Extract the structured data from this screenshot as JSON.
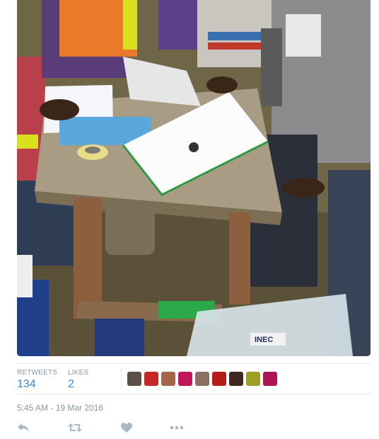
{
  "tweet": {
    "photo_alt": "Election officials sorting papers on a wooden table",
    "photo_sign_text": "INEC"
  },
  "stats": {
    "retweets_label": "RETWEETS",
    "retweets_value": "134",
    "likes_label": "LIKES",
    "likes_value": "2"
  },
  "avatars": [
    {
      "name": "avatar-1",
      "color": "#5b5045"
    },
    {
      "name": "avatar-2",
      "color": "#c62828"
    },
    {
      "name": "avatar-3",
      "color": "#a0654a"
    },
    {
      "name": "avatar-4",
      "color": "#c2185b"
    },
    {
      "name": "avatar-5",
      "color": "#8d6e63"
    },
    {
      "name": "avatar-6",
      "color": "#b71c1c"
    },
    {
      "name": "avatar-7",
      "color": "#3e2723"
    },
    {
      "name": "avatar-8",
      "color": "#9e9d24"
    },
    {
      "name": "avatar-9",
      "color": "#ad1457"
    }
  ],
  "timestamp": "5:45 AM - 19 Mar 2016",
  "actions": {
    "reply_icon": "reply-icon",
    "retweet_icon": "retweet-icon",
    "like_icon": "heart-icon",
    "more_icon": "more-dots-icon"
  },
  "colors": {
    "link_blue": "#3b88c3",
    "muted_gray": "#8899a6",
    "icon_gray": "#aab8c2",
    "divider": "#e1e8ed"
  }
}
